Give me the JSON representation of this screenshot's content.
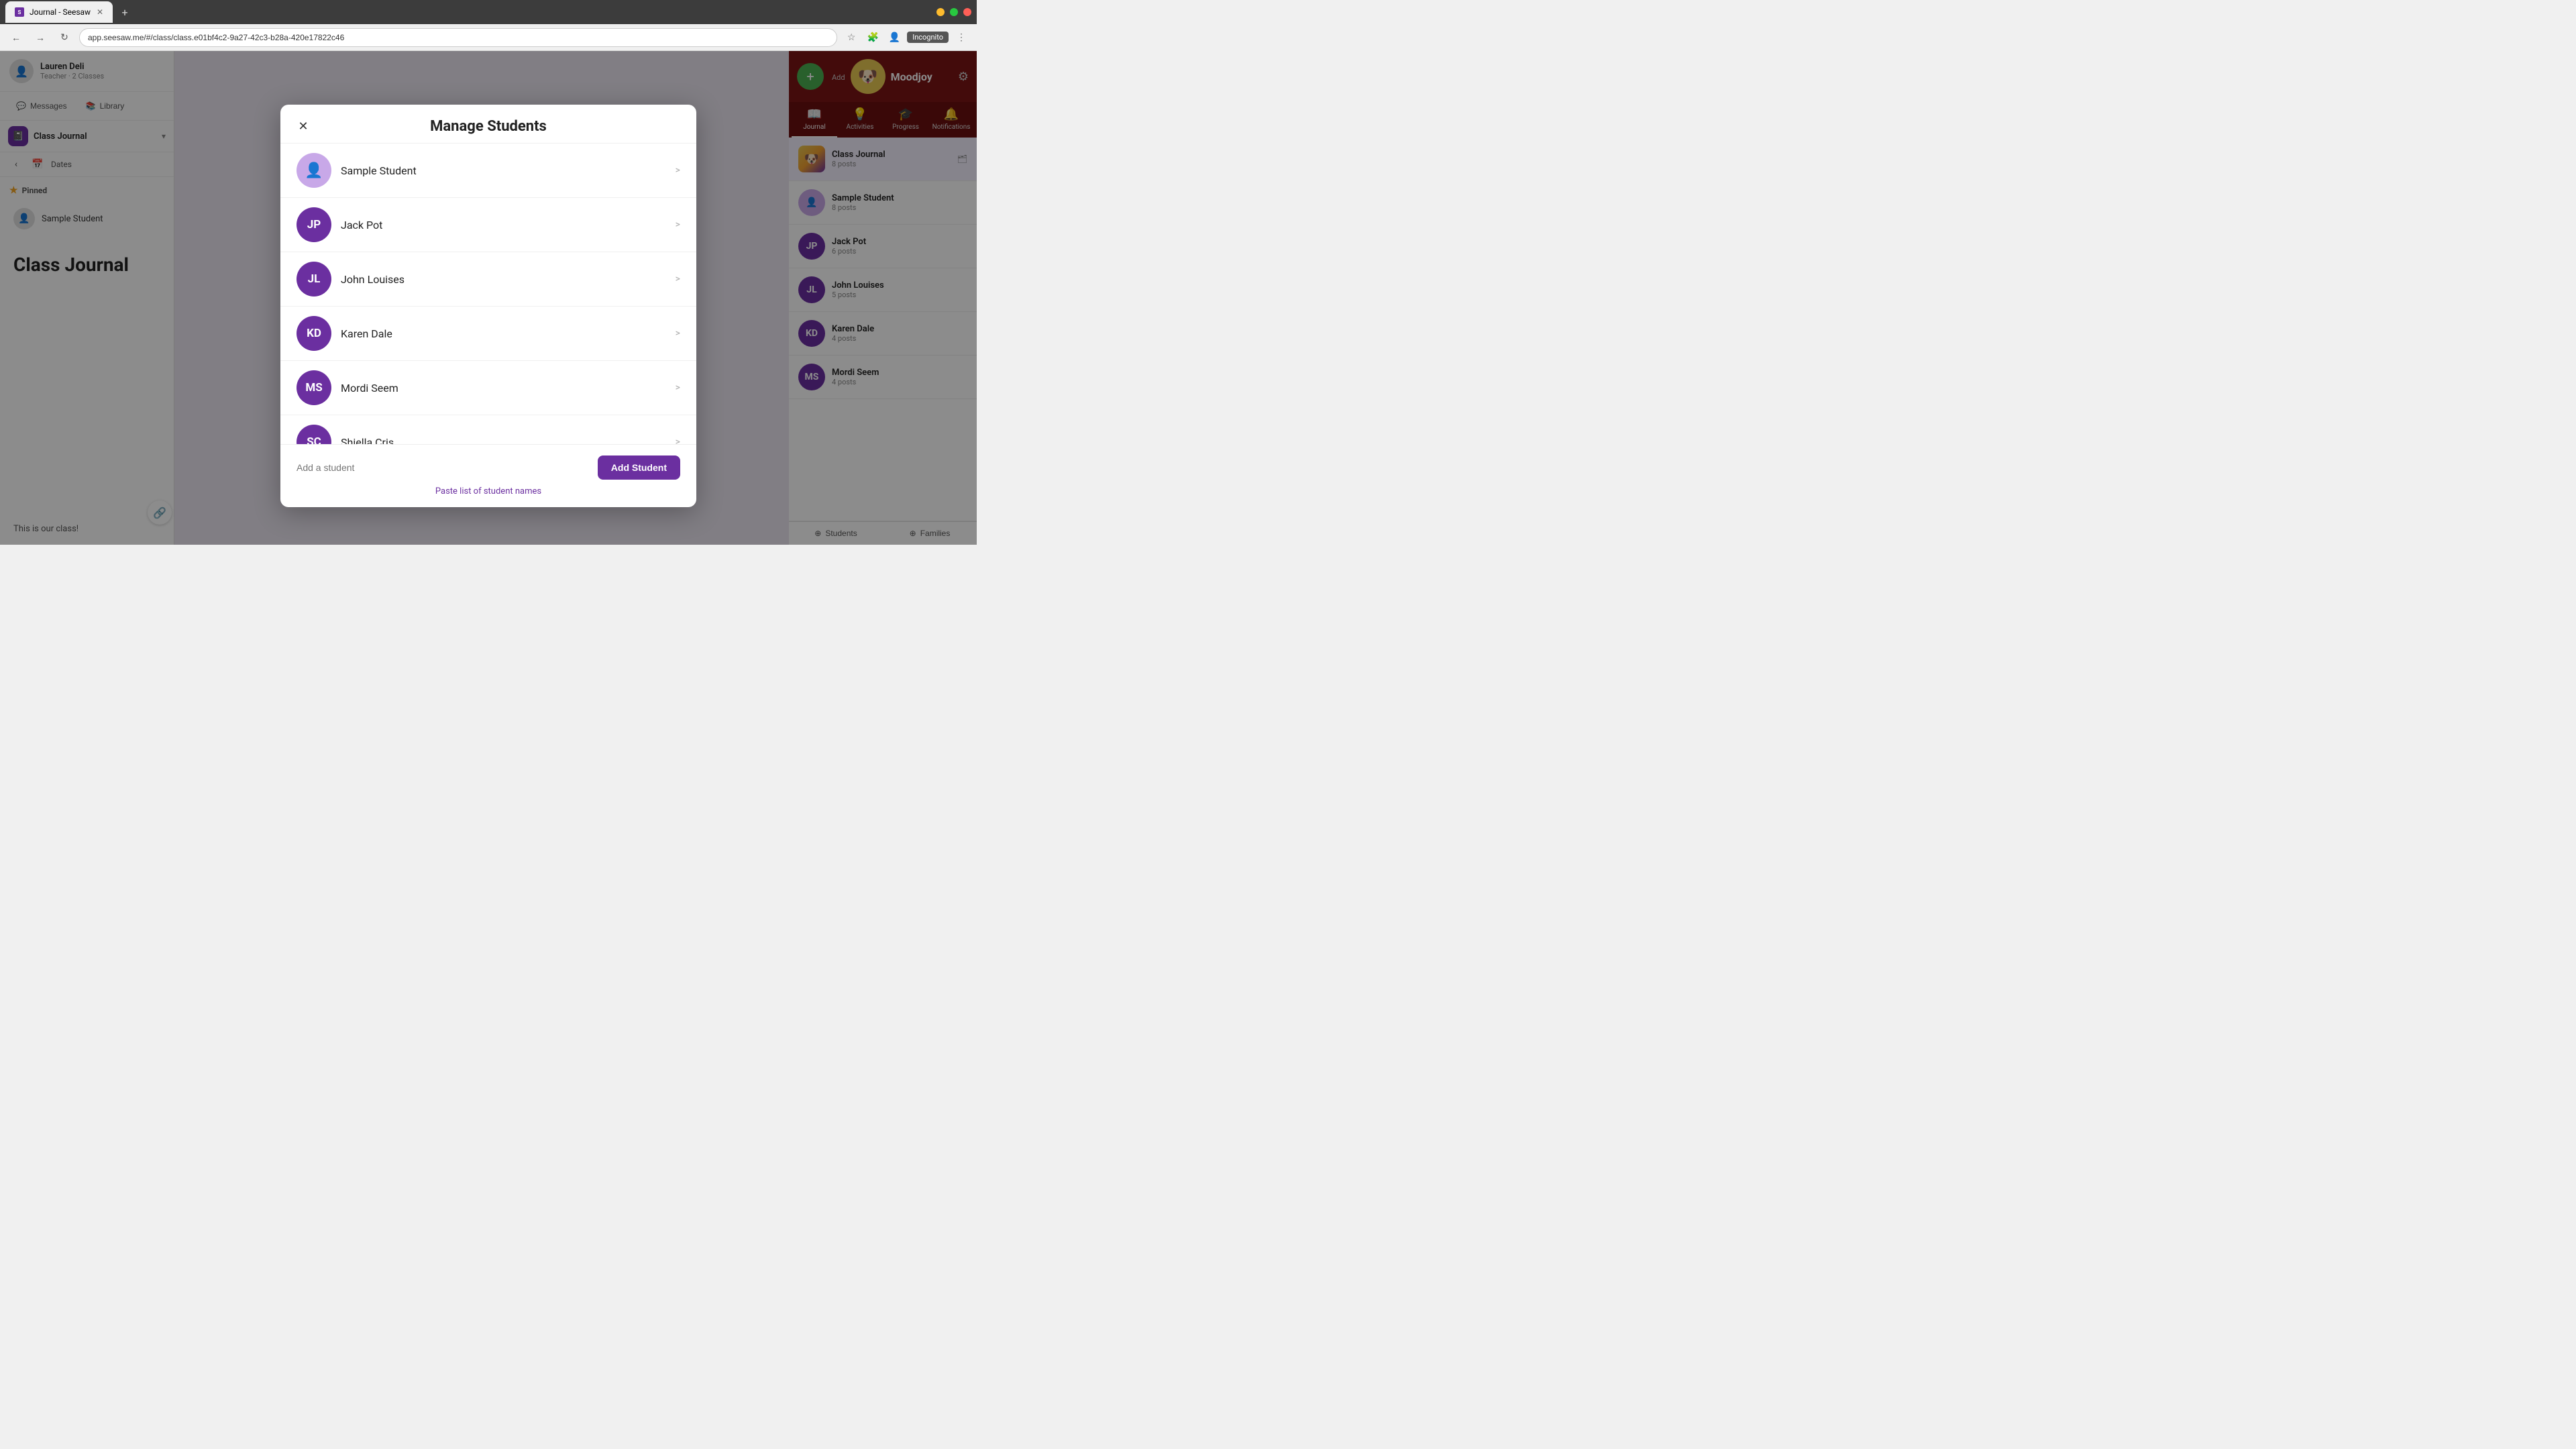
{
  "browser": {
    "tab_title": "Journal - Seesaw",
    "tab_favicon": "S",
    "url": "app.seesaw.me/#/class/class.e01bf4c2-9a27-42c3-b28a-420e17822c46",
    "new_tab_label": "+",
    "incognito_label": "Incognito"
  },
  "sidebar": {
    "teacher_name": "Lauren Deli",
    "teacher_role": "Teacher · 2 Classes",
    "messages_label": "Messages",
    "library_label": "Library",
    "class_name": "Class Journal",
    "dates_label": "Dates",
    "pinned_label": "Pinned",
    "pinned_student": "Sample Student",
    "page_title": "Class Journal"
  },
  "main": {
    "class_text": "This is our class!"
  },
  "right_panel": {
    "moodjoy_label": "Moodjoy",
    "add_label": "Add",
    "nav_items": [
      {
        "id": "journal",
        "label": "Journal",
        "icon": "📖",
        "active": true
      },
      {
        "id": "activities",
        "label": "Activities",
        "icon": "💡",
        "active": false
      },
      {
        "id": "progress",
        "label": "Progress",
        "icon": "🎓",
        "active": false
      },
      {
        "id": "notifications",
        "label": "Notifications",
        "icon": "🔔",
        "active": false
      }
    ],
    "class_journal_label": "Class Journal",
    "class_journal_posts": "8 posts",
    "folder_icon": "🗂",
    "students": [
      {
        "id": "sample-student",
        "initials": "",
        "name": "Sample Student",
        "posts": "8 posts",
        "color": "#c8a8e8",
        "is_sample": true
      },
      {
        "id": "jack-pot",
        "initials": "JP",
        "name": "Jack Pot",
        "posts": "6 posts",
        "color": "#6b2fa0"
      },
      {
        "id": "john-louises",
        "initials": "JL",
        "name": "John Louises",
        "posts": "5 posts",
        "color": "#6b2fa0"
      },
      {
        "id": "karen-dale",
        "initials": "KD",
        "name": "Karen Dale",
        "posts": "4 posts",
        "color": "#6b2fa0"
      },
      {
        "id": "mordi-seem",
        "initials": "MS",
        "name": "Mordi Seem",
        "posts": "4 posts",
        "color": "#6b2fa0"
      }
    ],
    "students_btn": "Students",
    "families_btn": "Families"
  },
  "modal": {
    "title": "Manage Students",
    "students": [
      {
        "id": "sample-student",
        "initials": "",
        "name": "Sample Student",
        "color": "#c8a8e8",
        "is_sample": true
      },
      {
        "id": "jack-pot",
        "initials": "JP",
        "name": "Jack Pot",
        "color": "#6b2fa0"
      },
      {
        "id": "john-louises",
        "initials": "JL",
        "name": "John Louises",
        "color": "#6b2fa0"
      },
      {
        "id": "karen-dale",
        "initials": "KD",
        "name": "Karen Dale",
        "color": "#6b2fa0"
      },
      {
        "id": "mordi-seem",
        "initials": "MS",
        "name": "Mordi Seem",
        "color": "#6b2fa0"
      },
      {
        "id": "shiella-cris",
        "initials": "SC",
        "name": "Shiella Cris",
        "color": "#6b2fa0"
      }
    ],
    "add_placeholder": "Add a student",
    "add_button_label": "Add Student",
    "paste_link_label": "Paste list of student names"
  },
  "icons": {
    "close": "✕",
    "chevron_right": ">",
    "chevron_down": "▾",
    "chevron_left": "‹",
    "back": "←",
    "forward": "→",
    "refresh": "↻",
    "star": "☆",
    "bookmark": "🔖",
    "extensions": "🧩",
    "profile": "👤",
    "more": "⋮",
    "gear": "⚙",
    "plus": "+",
    "link": "🔗",
    "messages": "💬",
    "library": "📚",
    "pin": "★"
  }
}
